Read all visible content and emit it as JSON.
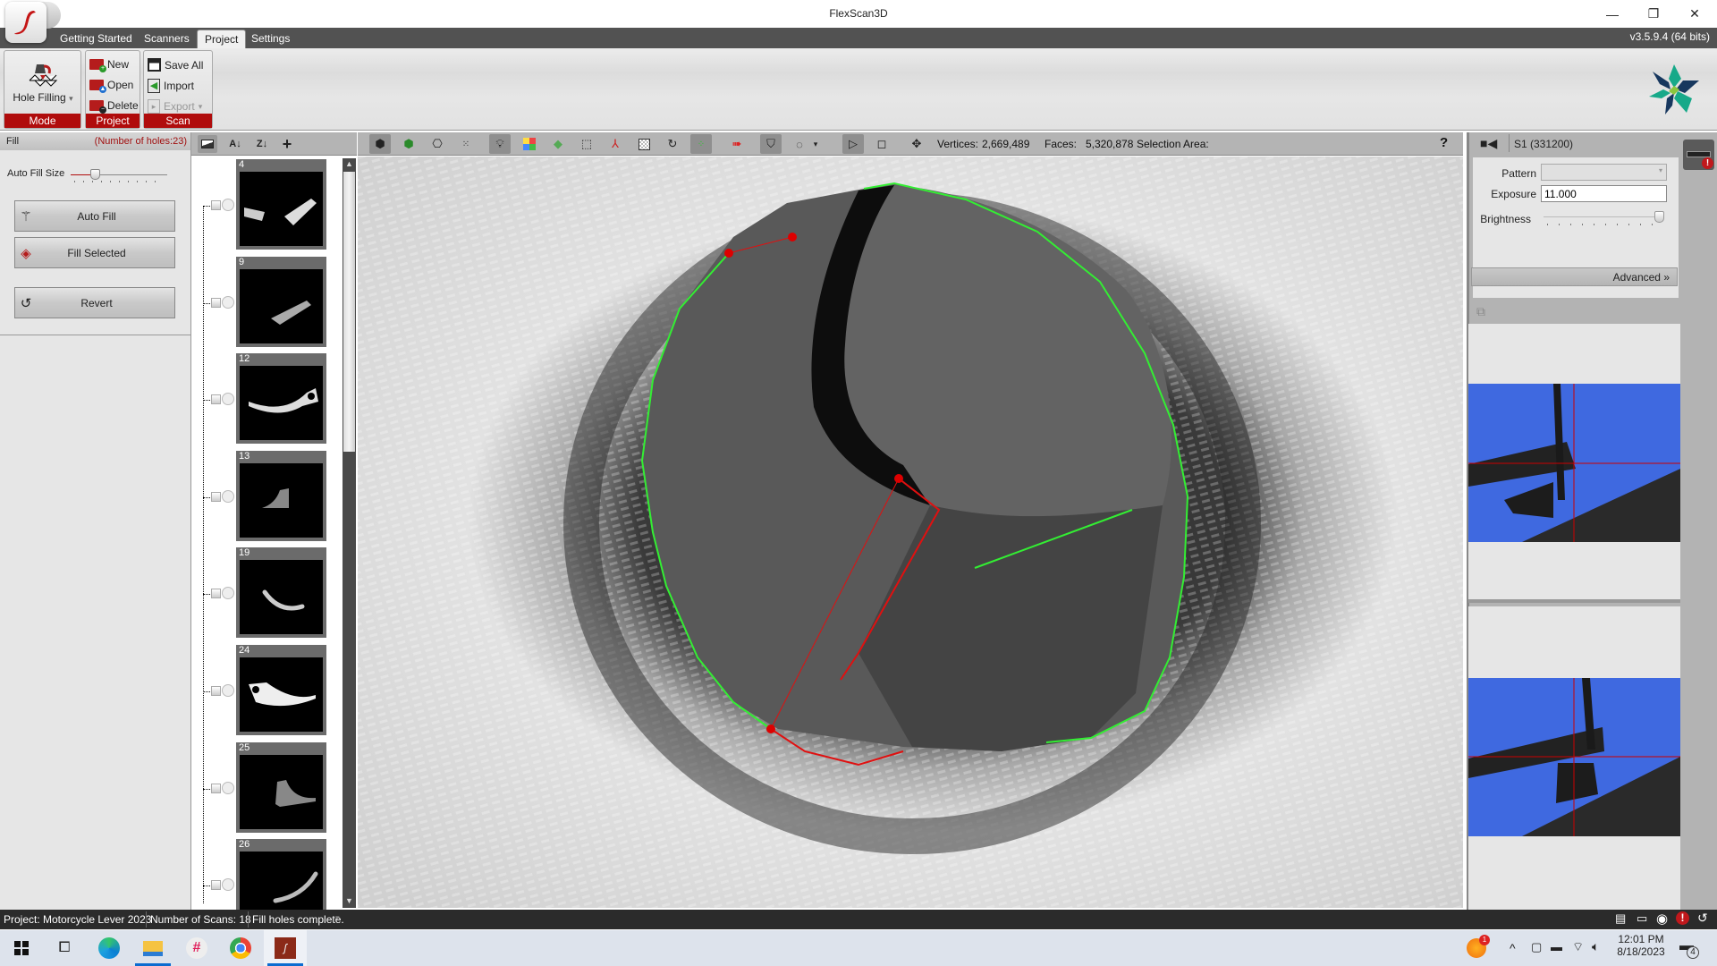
{
  "window": {
    "title": "FlexScan3D",
    "controls": {
      "minimize": "—",
      "restore": "❐",
      "close": "✕"
    }
  },
  "tabs": [
    {
      "label": "Getting Started",
      "active": false
    },
    {
      "label": "Scanners",
      "active": false
    },
    {
      "label": "Project",
      "active": true
    },
    {
      "label": "Settings",
      "active": false
    }
  ],
  "version": "v3.5.9.4  (64 bits)",
  "ribbon": {
    "mode": {
      "label": "Mode",
      "button": "Hole Filling"
    },
    "project": {
      "label": "Project",
      "new": "New",
      "open": "Open",
      "delete": "Delete"
    },
    "scan": {
      "label": "Scan",
      "save_all": "Save All",
      "import": "Import",
      "export": "Export"
    }
  },
  "fill_panel": {
    "title": "Fill",
    "holes_count": "(Number of holes:23)",
    "auto_fill_size_label": "Auto Fill Size",
    "auto_fill_size_value": 0.23,
    "buttons": {
      "auto_fill": "Auto Fill",
      "fill_selected": "Fill Selected",
      "revert": "Revert"
    }
  },
  "scan_list": {
    "items": [
      {
        "number": "4"
      },
      {
        "number": "9"
      },
      {
        "number": "12"
      },
      {
        "number": "13"
      },
      {
        "number": "19"
      },
      {
        "number": "24"
      },
      {
        "number": "25"
      },
      {
        "number": "26"
      }
    ]
  },
  "viewport_toolbar": {
    "vertices_label": "Vertices:",
    "vertices_value": "2,669,489",
    "faces_label": "Faces:",
    "faces_value": "5,320,878",
    "selection_label": "Selection Area:",
    "help": "?"
  },
  "camera_panel": {
    "title": "S1 (331200)",
    "pattern_label": "Pattern",
    "pattern_value": "",
    "exposure_label": "Exposure",
    "exposure_value": "11.000",
    "brightness_label": "Brightness",
    "brightness_value": 1.0,
    "advanced_label": "Advanced"
  },
  "statusbar": {
    "project": "Project:  Motorcycle Lever 2023",
    "scans": "Number of Scans:  18",
    "message": "Fill holes complete."
  },
  "taskbar": {
    "time": "12:01 PM",
    "date": "8/18/2023",
    "notification_count": "4",
    "badge_count": "1"
  },
  "colors": {
    "accent_red": "#b00c0c",
    "boundary_green": "#33ee33",
    "selection_red": "#e01010",
    "camera_blue": "#3f69e0"
  }
}
